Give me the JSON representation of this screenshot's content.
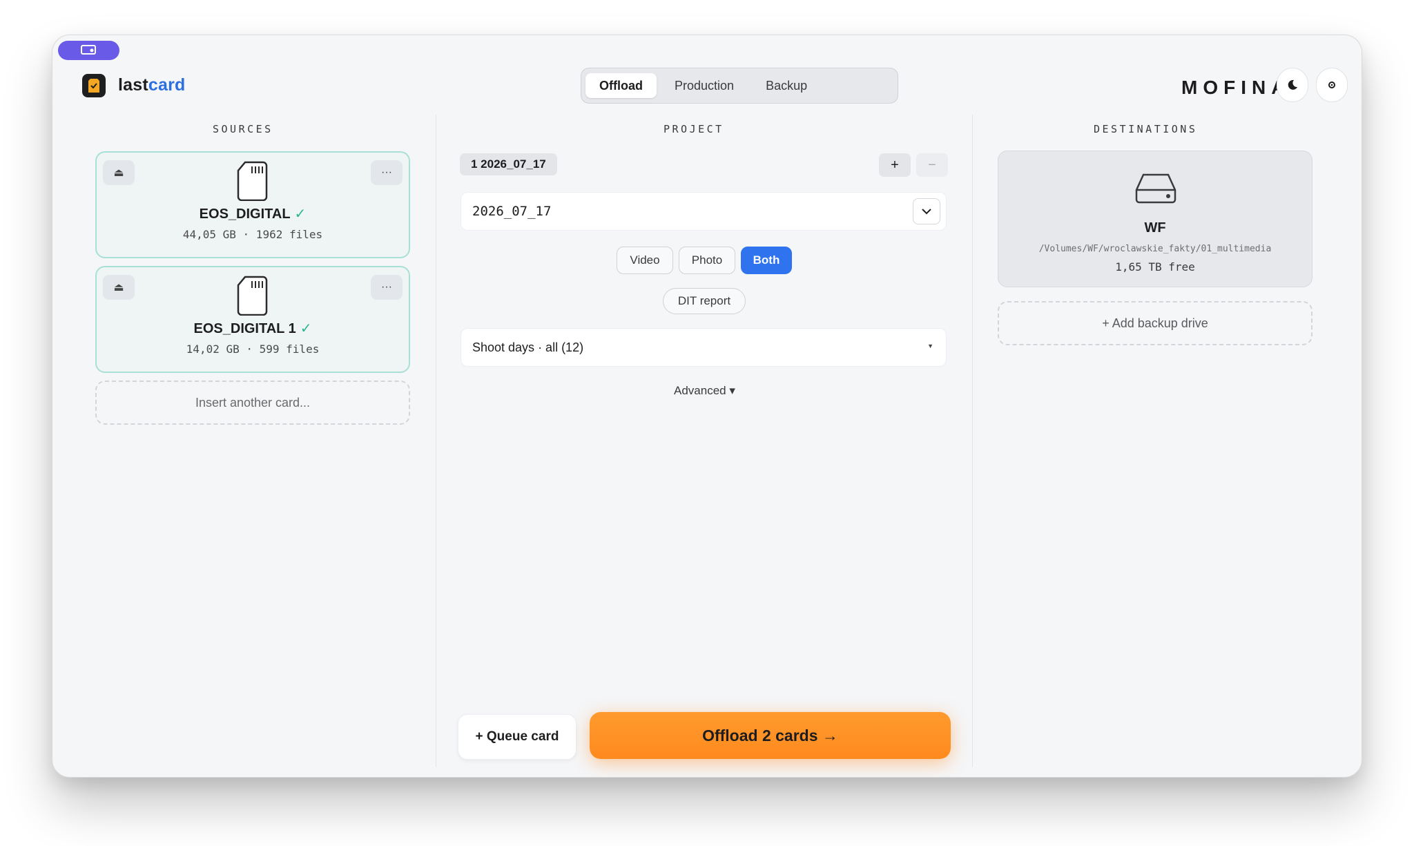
{
  "app": {
    "name_part1": "last",
    "name_part2": "card",
    "brand": "MOFINA"
  },
  "tabs": [
    {
      "label": "Offload",
      "active": true
    },
    {
      "label": "Production",
      "active": false
    },
    {
      "label": "Backup",
      "active": false
    }
  ],
  "sources": {
    "title": "SOURCES",
    "cards": [
      {
        "name": "EOS_DIGITAL",
        "check": "✓",
        "meta": "44,05 GB · 1962 files"
      },
      {
        "name": "EOS_DIGITAL 1",
        "check": "✓",
        "meta": "14,02 GB · 599 files"
      }
    ],
    "insert_label": "Insert another card..."
  },
  "project": {
    "title": "PROJECT",
    "chip": "1  2026_07_17",
    "add_label": "+",
    "remove_label": "−",
    "name_value": "2026_07_17",
    "media_types": [
      {
        "label": "Video",
        "active": false
      },
      {
        "label": "Photo",
        "active": false
      },
      {
        "label": "Both",
        "active": true
      }
    ],
    "dit_report": "DIT report",
    "shoot_days": "Shoot days · all (12)",
    "advanced": "Advanced ▾"
  },
  "actions": {
    "queue_label": "+ Queue card",
    "offload_label": "Offload 2 cards →"
  },
  "destinations": {
    "title": "DESTINATIONS",
    "drive": {
      "name": "WF",
      "path": "/Volumes/WF/wroclawskie_fakty/01_multimedia",
      "free": "1,65 TB free"
    },
    "add_label": "+ Add backup drive"
  },
  "colors": {
    "accent": "#2f73ef",
    "offload": "#ff8a1e",
    "source_border": "#a8e0d5",
    "share_pill": "#6a5ae8"
  }
}
